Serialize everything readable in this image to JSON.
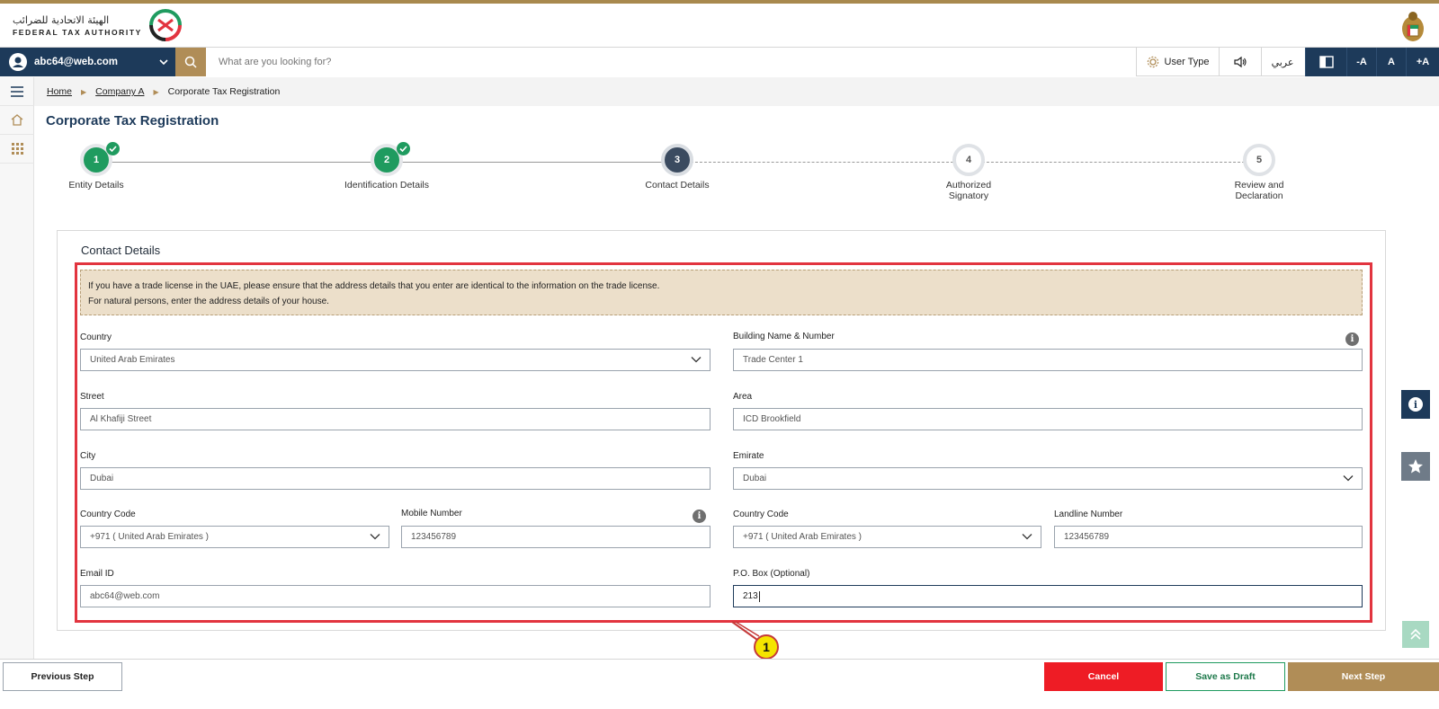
{
  "header": {
    "logo_arabic": "الهيئة الاتحادية للضرائب",
    "logo_english": "FEDERAL TAX AUTHORITY"
  },
  "navbar": {
    "user_email": "abc64@web.com",
    "search_placeholder": "What are you looking for?",
    "user_type_label": "User Type",
    "arabic_label": "عربي",
    "font_decrease": "-A",
    "font_normal": "A",
    "font_increase": "+A"
  },
  "breadcrumb": {
    "home": "Home",
    "company": "Company A",
    "current": "Corporate Tax Registration"
  },
  "page_title": "Corporate Tax Registration",
  "stepper": {
    "steps": [
      {
        "number": "1",
        "label": "Entity Details",
        "status": "completed"
      },
      {
        "number": "2",
        "label": "Identification Details",
        "status": "completed"
      },
      {
        "number": "3",
        "label": "Contact Details",
        "status": "current"
      },
      {
        "number": "4",
        "label": "Authorized Signatory",
        "status": "pending"
      },
      {
        "number": "5",
        "label": "Review and Declaration",
        "status": "pending"
      }
    ]
  },
  "card": {
    "title": "Contact Details",
    "notice_line1": "If you have a trade license in the UAE, please ensure that the address details that you enter are identical to the information on the trade license.",
    "notice_line2": "For natural persons, enter the address details of your house."
  },
  "form": {
    "country": {
      "label": "Country",
      "value": "United Arab Emirates"
    },
    "building": {
      "label": "Building Name & Number",
      "value": "Trade Center 1"
    },
    "street": {
      "label": "Street",
      "value": "Al Khafiji Street"
    },
    "area": {
      "label": "Area",
      "value": "ICD Brookfield"
    },
    "city": {
      "label": "City",
      "value": "Dubai"
    },
    "emirate": {
      "label": "Emirate",
      "value": "Dubai"
    },
    "mobile_country_code": {
      "label": "Country Code",
      "value": "+971 ( United Arab Emirates )"
    },
    "mobile_number": {
      "label": "Mobile Number",
      "value": "123456789"
    },
    "landline_country_code": {
      "label": "Country Code",
      "value": "+971 ( United Arab Emirates )"
    },
    "landline_number": {
      "label": "Landline Number",
      "value": "123456789"
    },
    "email": {
      "label": "Email ID",
      "value": "abc64@web.com"
    },
    "po_box": {
      "label": "P.O. Box (Optional)",
      "value": "213"
    }
  },
  "callout_number": "1",
  "footer": {
    "previous": "Previous Step",
    "cancel": "Cancel",
    "save_draft": "Save as Draft",
    "next": "Next Step"
  },
  "colors": {
    "navy": "#1d3a5a",
    "gold": "#b08d57",
    "green": "#1f9b5f",
    "red": "#ee1c25",
    "highlight": "#e2343f"
  }
}
